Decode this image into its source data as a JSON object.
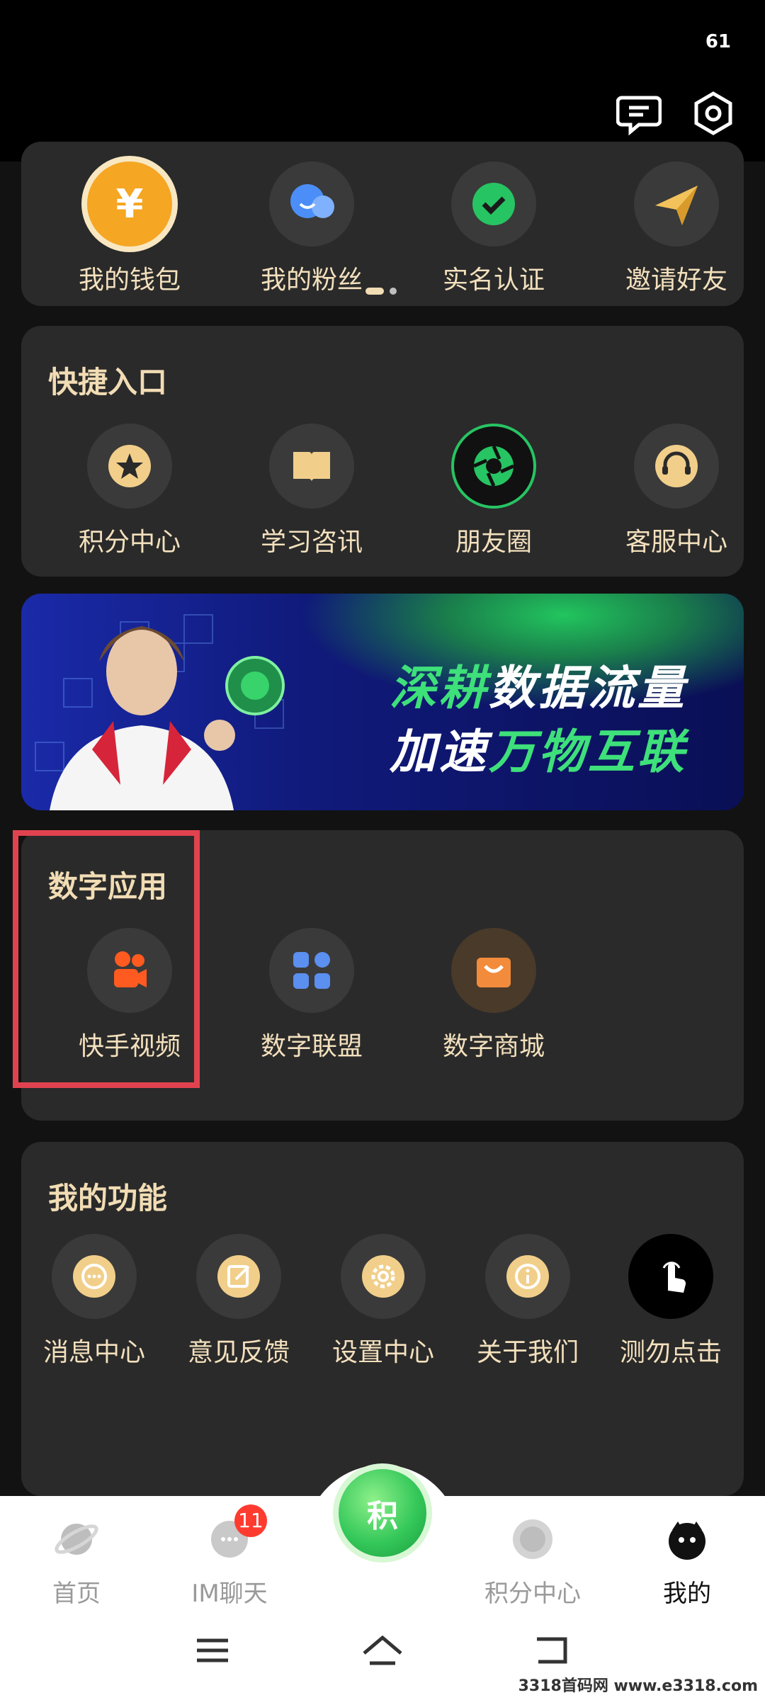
{
  "status": {
    "battery": "61"
  },
  "wallet_row": {
    "items": [
      {
        "label": "我的钱包",
        "icon": "yuan-icon"
      },
      {
        "label": "我的粉丝",
        "icon": "fans-icon"
      },
      {
        "label": "实名认证",
        "icon": "check-icon"
      },
      {
        "label": "邀请好友",
        "icon": "paper-plane-icon"
      }
    ]
  },
  "quick_entry": {
    "title": "快捷入口",
    "items": [
      {
        "label": "积分中心",
        "icon": "star-icon"
      },
      {
        "label": "学习咨讯",
        "icon": "book-icon"
      },
      {
        "label": "朋友圈",
        "icon": "camera-aperture-icon"
      },
      {
        "label": "客服中心",
        "icon": "headset-icon"
      }
    ]
  },
  "banner": {
    "line1_a": "深耕",
    "line1_b": "数据流量",
    "line2_a": "加速",
    "line2_b": "万物互联"
  },
  "digital_apps": {
    "title": "数字应用",
    "items": [
      {
        "label": "快手视频",
        "icon": "kuaishou-icon"
      },
      {
        "label": "数字联盟",
        "icon": "grid-icon"
      },
      {
        "label": "数字商城",
        "icon": "shopping-bag-icon"
      }
    ]
  },
  "my_functions": {
    "title": "我的功能",
    "items": [
      {
        "label": "消息中心",
        "icon": "message-icon"
      },
      {
        "label": "意见反馈",
        "icon": "edit-icon"
      },
      {
        "label": "设置中心",
        "icon": "gear-icon"
      },
      {
        "label": "关于我们",
        "icon": "info-icon"
      },
      {
        "label": "测勿点击",
        "icon": "tap-icon"
      }
    ]
  },
  "bottom_nav": {
    "items": [
      {
        "label": "首页"
      },
      {
        "label": "IM聊天",
        "badge": "11"
      },
      {
        "label": "积分中心"
      },
      {
        "label": "我的"
      }
    ],
    "center_label": "积"
  },
  "watermark": "3318首码网 www.e3318.com",
  "colors": {
    "accent": "#f1dcb4",
    "highlight": "#e0434f",
    "green": "#3ee07a"
  }
}
